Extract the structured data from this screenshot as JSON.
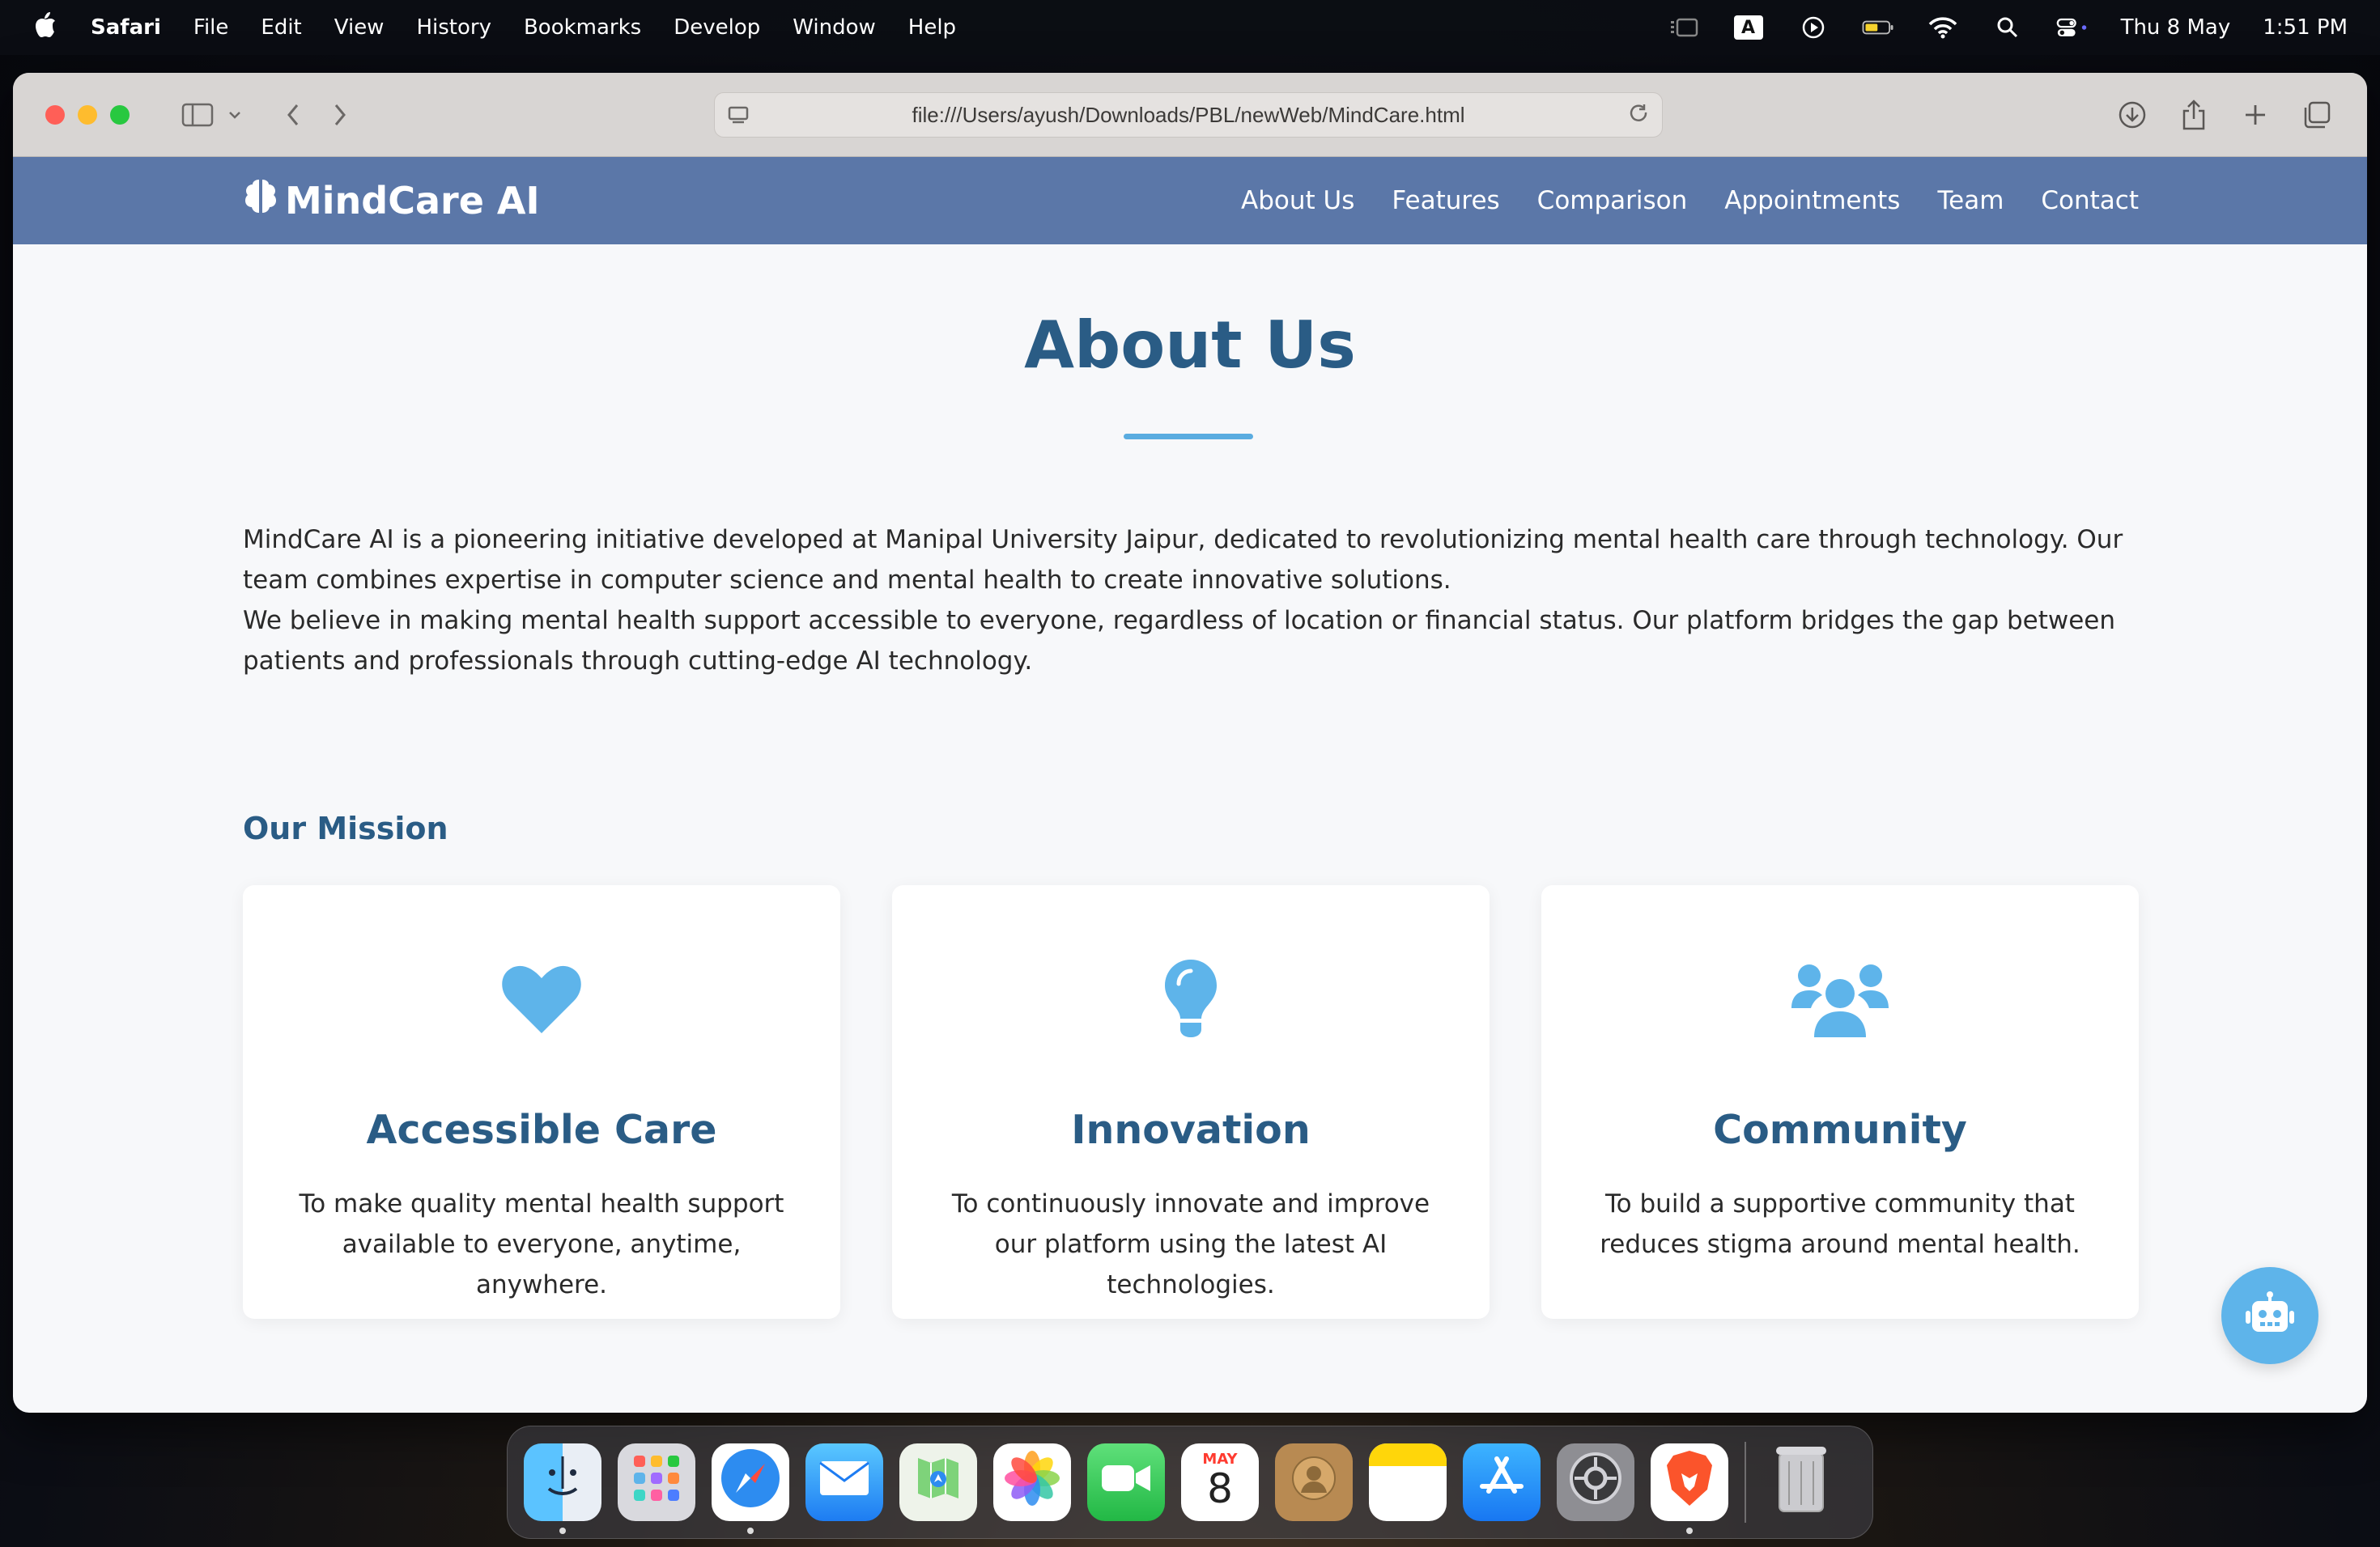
{
  "menubar": {
    "app_name": "Safari",
    "menus": [
      "File",
      "Edit",
      "View",
      "History",
      "Bookmarks",
      "Develop",
      "Window",
      "Help"
    ],
    "date": "Thu 8 May",
    "time": "1:51 PM",
    "input_badge": "A"
  },
  "browser": {
    "url": "file:///Users/ayush/Downloads/PBL/newWeb/MindCare.html"
  },
  "site": {
    "logo": "MindCare AI",
    "nav": [
      "About Us",
      "Features",
      "Comparison",
      "Appointments",
      "Team",
      "Contact"
    ],
    "nav_color": "#5b77a8",
    "accent": "#5eb4ea",
    "heading_color": "#2a5c85"
  },
  "about": {
    "title": "About Us",
    "para1": "MindCare AI is a pioneering initiative developed at Manipal University Jaipur, dedicated to revolutionizing mental health care through technology. Our team combines expertise in computer science and mental health to create innovative solutions.",
    "para2": "We believe in making mental health support accessible to everyone, regardless of location or financial status. Our platform bridges the gap between patients and professionals through cutting-edge AI technology.",
    "mission_heading": "Our Mission",
    "cards": [
      {
        "icon": "heart-icon",
        "title": "Accessible Care",
        "text": "To make quality mental health support available to everyone, anytime, anywhere."
      },
      {
        "icon": "lightbulb-icon",
        "title": "Innovation",
        "text": "To continuously innovate and improve our platform using the latest AI technologies."
      },
      {
        "icon": "users-icon",
        "title": "Community",
        "text": "To build a supportive community that reduces stigma around mental health."
      }
    ]
  },
  "dock": {
    "apps": [
      "Finder",
      "Launchpad",
      "Safari",
      "Mail",
      "Maps",
      "Photos",
      "FaceTime",
      "Calendar",
      "Contacts",
      "Notes",
      "App Store",
      "System Settings",
      "Brave",
      "Trash"
    ],
    "calendar_month": "MAY",
    "calendar_day": "8"
  }
}
